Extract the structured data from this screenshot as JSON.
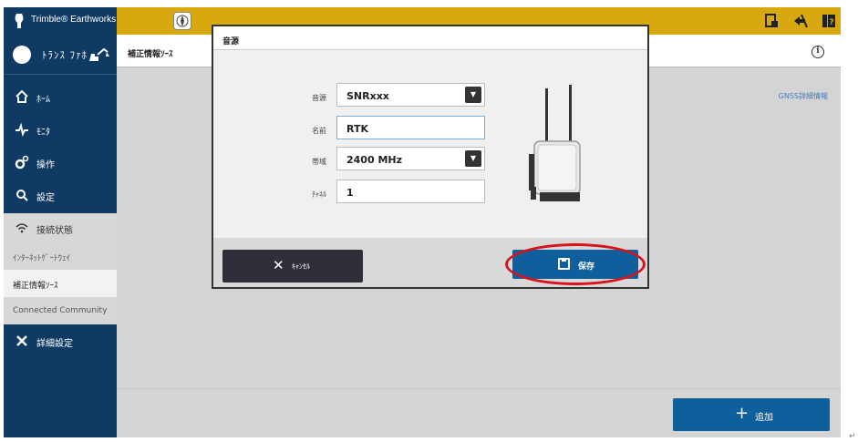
{
  "app": {
    "brand": "Trimble® Earthworks"
  },
  "topbar": {
    "icons": [
      "compass-icon",
      "report-icon",
      "survey-icon",
      "help-icon"
    ]
  },
  "sidebar": {
    "machine_name": "ﾄﾗﾝｽ ﾌｧﾎ",
    "items": [
      {
        "label": "ﾎｰﾑ",
        "icon": "home-icon"
      },
      {
        "label": "ﾓﾆﾀ",
        "icon": "monitor-icon"
      },
      {
        "label": "操作",
        "icon": "operate-icon"
      },
      {
        "label": "設定",
        "icon": "settings-icon"
      },
      {
        "label": "接続状態",
        "icon": "wifi-icon"
      }
    ],
    "sub_items": [
      {
        "label": "ｲﾝﾀｰﾈｯﾄｹﾞｰﾄｳｪｲ"
      },
      {
        "label": "補正情報ｿｰｽ"
      },
      {
        "label": "Connected Community"
      }
    ],
    "advanced": {
      "label": "詳細設定",
      "icon": "tools-icon"
    }
  },
  "main": {
    "title": "補正情報ｿｰｽ",
    "gnss_link": "GNSS詳細情報",
    "add_label": "追加"
  },
  "modal": {
    "title": "音源",
    "fields": {
      "source": {
        "label": "音源",
        "value": "SNRxxx"
      },
      "name": {
        "label": "名前",
        "value": "RTK"
      },
      "band": {
        "label": "帯域",
        "value": "2400 MHz"
      },
      "channel": {
        "label": "ﾁｬﾈﾙ",
        "value": "1"
      }
    },
    "cancel_label": "ｷｬﾝｾﾙ",
    "save_label": "保存"
  },
  "colors": {
    "topbar": "#d8a90f",
    "sidebar": "#0f3a63",
    "primary_button": "#0f5f9c",
    "highlight": "#d9121b"
  }
}
